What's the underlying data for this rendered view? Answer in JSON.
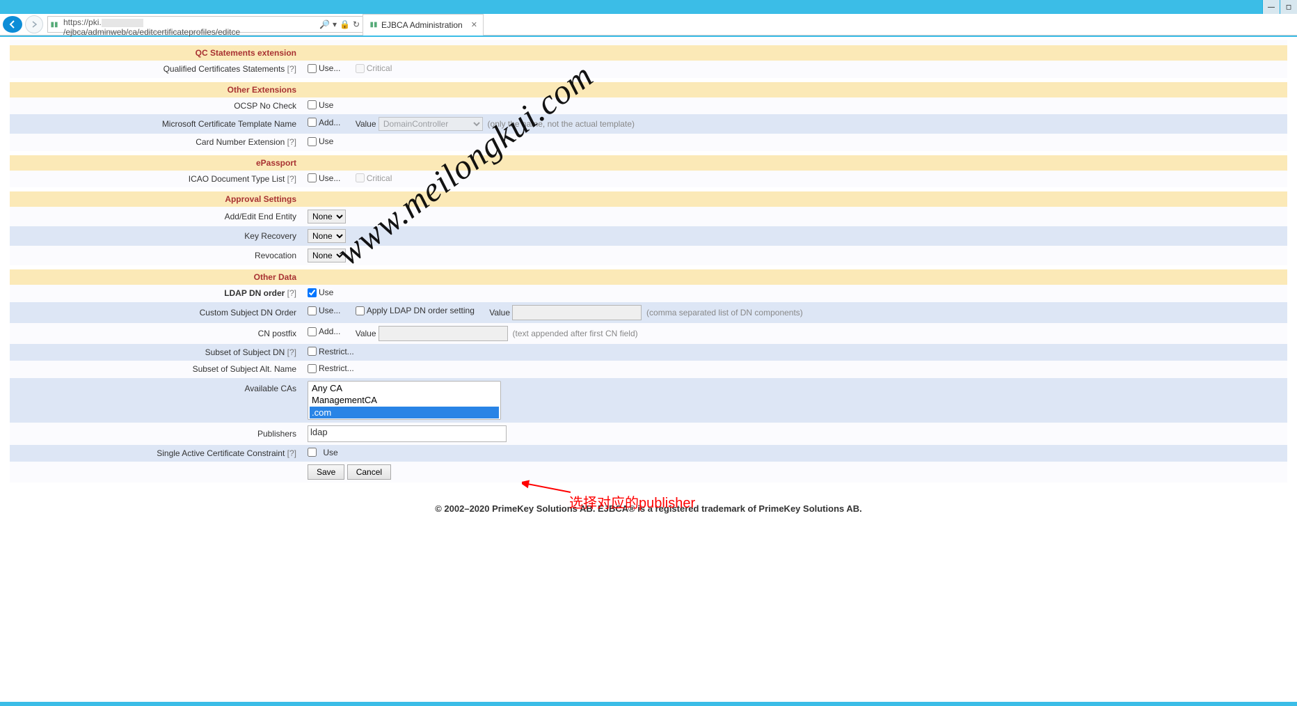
{
  "browser": {
    "url_prefix": "https://pki.",
    "url_suffix": "/ejbca/adminweb/ca/editcertificateprofiles/editce",
    "tab_title": "EJBCA Administration"
  },
  "sections": {
    "qc": "QC Statements extension",
    "other_ext": "Other Extensions",
    "epassport": "ePassport",
    "approval": "Approval Settings",
    "other_data": "Other Data"
  },
  "labels": {
    "qcs": "Qualified Certificates Statements",
    "ocsp": "OCSP No Check",
    "mstpl": "Microsoft Certificate Template Name",
    "cardnum": "Card Number Extension",
    "icao": "ICAO Document Type List",
    "addedit": "Add/Edit End Entity",
    "keyrec": "Key Recovery",
    "revoc": "Revocation",
    "ldapdn": "LDAP DN order",
    "csdo": "Custom Subject DN Order",
    "cnpost": "CN postfix",
    "subdn": "Subset of Subject DN",
    "subalt": "Subset of Subject Alt. Name",
    "availcas": "Available CAs",
    "publishers": "Publishers",
    "sacc": "Single Active Certificate Constraint"
  },
  "opts": {
    "use": "Use",
    "use_e": "Use...",
    "critical": "Critical",
    "add_e": "Add...",
    "restrict_e": "Restrict...",
    "apply_ldap": "Apply LDAP DN order setting",
    "value": "Value",
    "any_ca": "Any CA",
    "mgmt_ca": "ManagementCA",
    "third_ca": ".com",
    "pub_ldap": "ldap",
    "save": "Save",
    "cancel": "Cancel"
  },
  "hints": {
    "mstpl": "(only the name, not the actual template)",
    "csdo": "(comma separated list of DN components)",
    "cnpost": "(text appended after first CN field)"
  },
  "dropdowns": {
    "none": "None",
    "dc": "DomainController"
  },
  "help": "[?]",
  "footer": "© 2002–2020 PrimeKey Solutions AB. EJBCA® is a registered trademark of PrimeKey Solutions AB.",
  "annotation": "选择对应的publisher",
  "watermark": "www.meilongkui.com"
}
